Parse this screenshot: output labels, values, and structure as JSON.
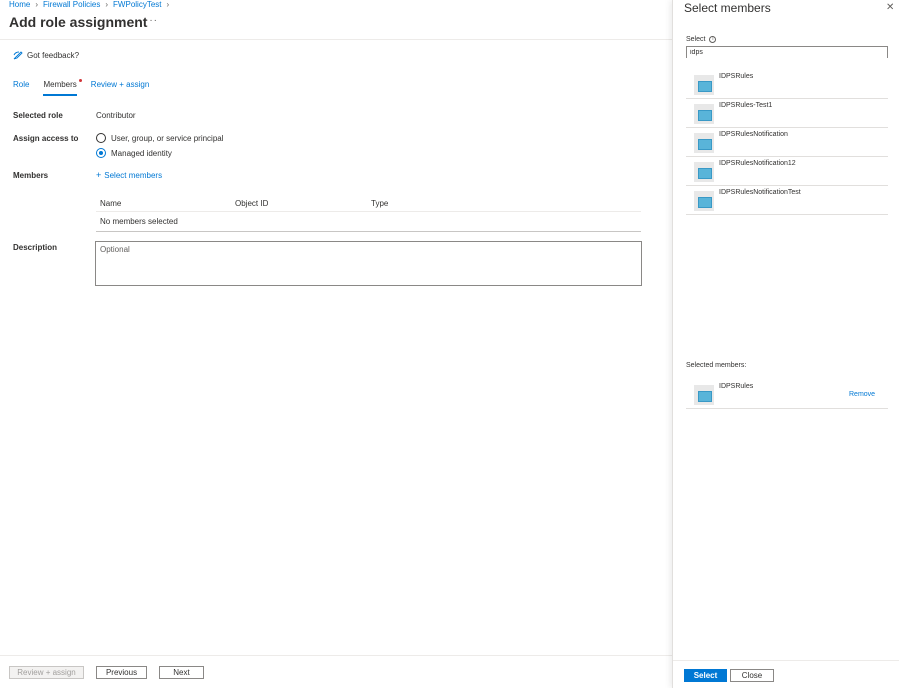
{
  "breadcrumb": [
    "Home",
    "Firewall Policies",
    "FWPolicyTest"
  ],
  "page": {
    "title": "Add role assignment",
    "more": "···"
  },
  "toolbar": {
    "feedback_label": "Got feedback?"
  },
  "tabs": [
    {
      "label": "Role"
    },
    {
      "label": "Members"
    },
    {
      "label": "Review + assign"
    }
  ],
  "form": {
    "selected_role_label": "Selected role",
    "selected_role_value": "Contributor",
    "assign_access_label": "Assign access to",
    "assign_options": [
      "User, group, or service principal",
      "Managed identity"
    ],
    "assign_selected": "Managed identity",
    "members_label": "Members",
    "select_members_link": "Select members",
    "table_headers": [
      "Name",
      "Object ID",
      "Type"
    ],
    "table_empty": "No members selected",
    "description_label": "Description",
    "description_placeholder": "Optional"
  },
  "footer": {
    "review_assign": "Review + assign",
    "previous": "Previous",
    "next": "Next"
  },
  "panel": {
    "title": "Select members",
    "select_label": "Select",
    "search_value": "idps",
    "results": [
      "IDPSRules",
      "IDPSRules-Test1",
      "IDPSRulesNotification",
      "IDPSRulesNotification12",
      "IDPSRulesNotificationTest"
    ],
    "selected_label": "Selected members:",
    "selected": [
      {
        "name": "IDPSRules",
        "remove": "Remove"
      }
    ],
    "select_button": "Select",
    "close_button": "Close"
  },
  "colors": {
    "accent": "#0078d4",
    "badge": "#d13438"
  }
}
